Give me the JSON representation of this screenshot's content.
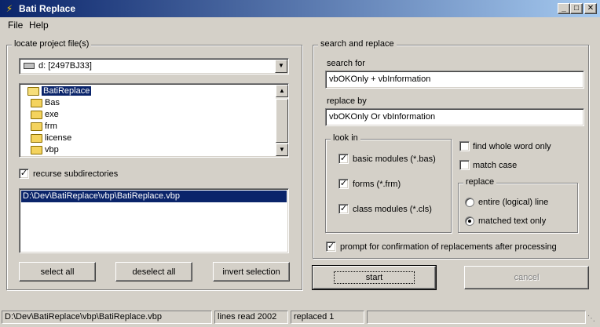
{
  "window": {
    "title": "Bati Replace"
  },
  "menu": [
    {
      "label": "File"
    },
    {
      "label": "Help"
    }
  ],
  "locate": {
    "group_label": "locate project file(s)",
    "drive": "d: [2497BJ33]",
    "folders": [
      {
        "label": "BatiReplace",
        "open": true,
        "selected": true
      },
      {
        "label": "Bas"
      },
      {
        "label": "exe"
      },
      {
        "label": "frm"
      },
      {
        "label": "license"
      },
      {
        "label": "vbp"
      }
    ],
    "recurse_label": "recurse subdirectories",
    "recurse_checked": true,
    "files": [
      "D:\\Dev\\BatiReplace\\vbp\\BatiReplace.vbp"
    ],
    "buttons": {
      "select_all": "select all",
      "deselect_all": "deselect all",
      "invert": "invert selection"
    }
  },
  "search": {
    "group_label": "search and replace",
    "search_for_label": "search for",
    "search_for_value": "vbOKOnly + vbInformation",
    "replace_by_label": "replace by",
    "replace_by_value": "vbOKOnly Or vbInformation",
    "look_in": {
      "label": "look in",
      "options": [
        {
          "label": "basic modules (*.bas)",
          "checked": true
        },
        {
          "label": "forms (*.frm)",
          "checked": true
        },
        {
          "label": "class modules (*.cls)",
          "checked": true
        }
      ]
    },
    "find_whole_word": {
      "label": "find whole word only",
      "checked": false
    },
    "match_case": {
      "label": "match case",
      "checked": false
    },
    "replace_group": {
      "label": "replace",
      "options": [
        {
          "label": "entire (logical) line",
          "selected": false
        },
        {
          "label": "matched text only",
          "selected": true
        }
      ]
    },
    "prompt": {
      "label": "prompt for confirmation of replacements after processing",
      "checked": true
    }
  },
  "actions": {
    "start": "start",
    "cancel": "cancel"
  },
  "status": {
    "path": "D:\\Dev\\BatiReplace\\vbp\\BatiReplace.vbp",
    "lines": "lines read 2002",
    "replaced": "replaced 1"
  },
  "icons": {
    "app": "app-icon",
    "folder": "folder-icon",
    "drive": "drive-icon"
  }
}
